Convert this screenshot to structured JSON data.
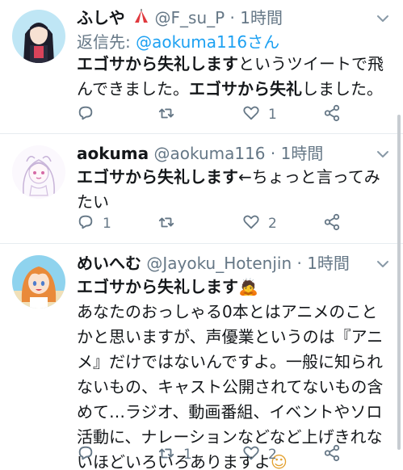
{
  "tweets": [
    {
      "name": "ふしや",
      "handle": "@F_su_P",
      "sep": " · ",
      "time": "1時間",
      "reply_prefix": "返信先: ",
      "reply_handle": "@aokuma116さん",
      "text_bold": "エゴサから失礼します",
      "text_rest": "というツイートで飛んできました。",
      "text_bold2": "エゴサから失礼",
      "text_rest2": "しました。",
      "replies": "",
      "retweets": "",
      "likes": "1"
    },
    {
      "name": "aokuma",
      "handle": "@aokuma116",
      "sep": " · ",
      "time": "1時間",
      "text_bold": "エゴサから失礼します",
      "text_rest": "←ちょっと言ってみたい",
      "replies": "1",
      "retweets": "",
      "likes": "2"
    },
    {
      "name": "めいへむ",
      "handle": "@Jayoku_Hotenjin",
      "sep": " · ",
      "time": "1時間",
      "text_bold": "エゴサから失礼します",
      "emoji1": "🙇",
      "text_rest": "あなたのおっしゃる0本とはアニメのことかと思いますが、声優業というのは『アニメ』だけではないんですよ。一般に知られないもの、キャスト公開されてないもの含めて…ラジオ、動画番組、イベントやソロ活動に、ナレーションなどなど上げきれないほどいろいろありますよ",
      "emoji2": "☺",
      "replies": "",
      "retweets": "1",
      "likes": "2"
    }
  ],
  "colors": {
    "accent": "#1da1f2",
    "muted": "#657786",
    "divider": "#e6ecf0"
  }
}
